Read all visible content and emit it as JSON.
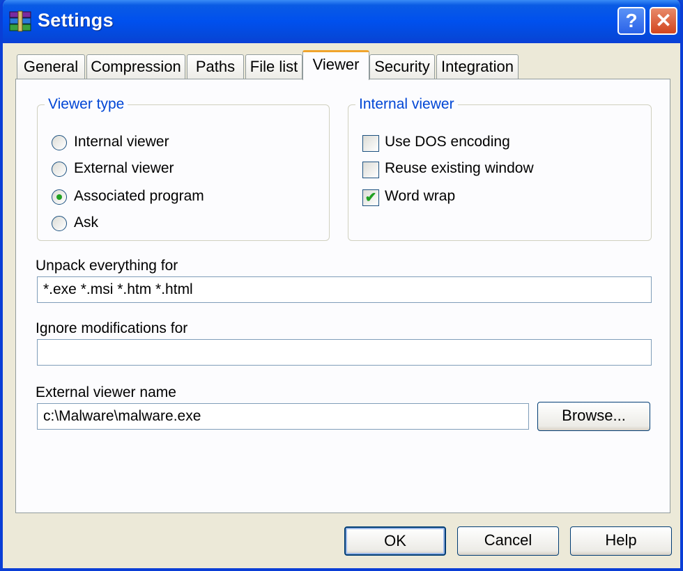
{
  "window": {
    "title": "Settings",
    "help_button": "?",
    "close_button": "✕"
  },
  "tabs": [
    {
      "label": "General"
    },
    {
      "label": "Compression"
    },
    {
      "label": "Paths"
    },
    {
      "label": "File list"
    },
    {
      "label": "Viewer",
      "active": true
    },
    {
      "label": "Security"
    },
    {
      "label": "Integration"
    }
  ],
  "viewer_type": {
    "legend": "Viewer type",
    "options": [
      {
        "label": "Internal viewer",
        "selected": false
      },
      {
        "label": "External viewer",
        "selected": false
      },
      {
        "label": "Associated program",
        "selected": true
      },
      {
        "label": "Ask",
        "selected": false
      }
    ]
  },
  "internal_viewer": {
    "legend": "Internal viewer",
    "options": [
      {
        "label": "Use DOS encoding",
        "checked": false
      },
      {
        "label": "Reuse existing window",
        "checked": false
      },
      {
        "label": "Word wrap",
        "checked": true
      }
    ]
  },
  "unpack_everything": {
    "label": "Unpack everything for",
    "value": "*.exe *.msi *.htm *.html"
  },
  "ignore_modifications": {
    "label": "Ignore modifications for",
    "value": ""
  },
  "external_viewer": {
    "label": "External viewer name",
    "value": "c:\\Malware\\malware.exe",
    "browse_label": "Browse..."
  },
  "buttons": {
    "ok": "OK",
    "cancel": "Cancel",
    "help": "Help"
  },
  "colors": {
    "title_bar": "#0050ee",
    "legend": "#0046d5",
    "active_tab_accent": "#f0a42c",
    "check_green": "#21a121"
  }
}
